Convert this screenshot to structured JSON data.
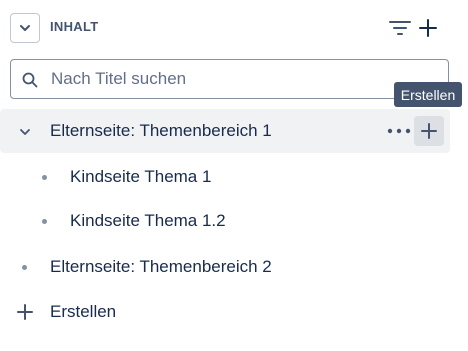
{
  "header": {
    "title": "INHALT",
    "collapse_icon": "chevron-down-icon",
    "filter_icon": "filter-icon",
    "add_icon": "plus-icon"
  },
  "search": {
    "placeholder": "Nach Titel suchen",
    "icon": "search-icon"
  },
  "tooltip": {
    "text": "Erstellen"
  },
  "tree": {
    "items": [
      {
        "label": "Elternseite: Themenbereich 1",
        "level": 0,
        "expanded": true,
        "selected": true
      },
      {
        "label": "Kindseite Thema 1",
        "level": 1
      },
      {
        "label": "Kindseite Thema 1.2",
        "level": 1
      },
      {
        "label": "Elternseite: Themenbereich 2",
        "level": 0,
        "expanded": false
      }
    ],
    "more_icon": "more-horizontal-icon",
    "add_icon": "plus-icon"
  },
  "create": {
    "label": "Erstellen",
    "icon": "plus-icon"
  },
  "colors": {
    "text": "#172b4d",
    "muted": "#44546f",
    "selected_bg": "#f1f2f4",
    "tooltip_bg": "#44546f"
  }
}
